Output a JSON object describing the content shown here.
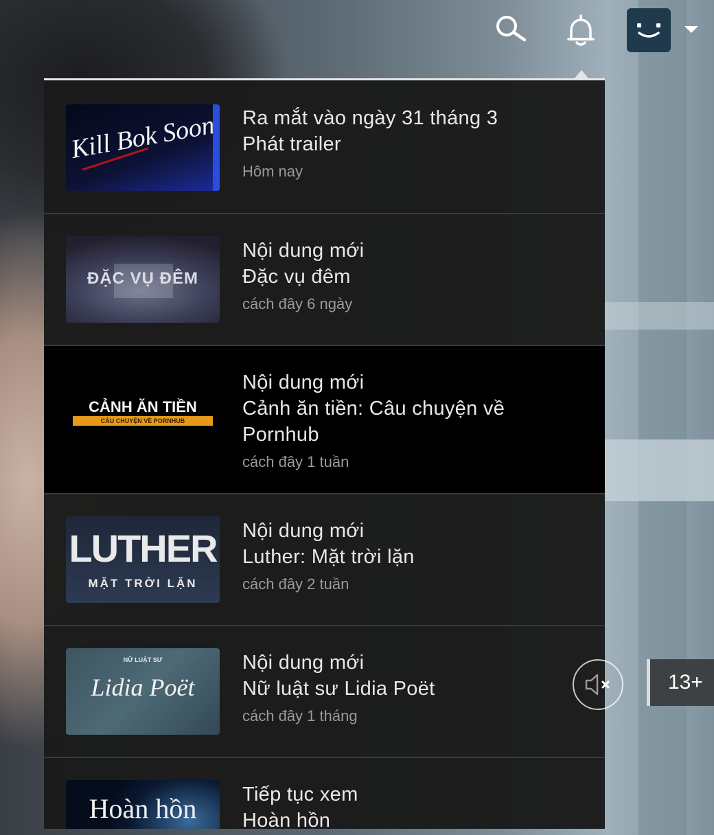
{
  "header": {
    "search_icon": "search-icon",
    "bell_icon": "bell-icon",
    "profile_icon": "profile-avatar-icon",
    "caret_icon": "caret-down-icon"
  },
  "notifications": [
    {
      "line1": "Ra mắt vào ngày 31 tháng 3",
      "line2": "Phát trailer",
      "time": "Hôm nay",
      "thumb_text": "Kill Bok Soon"
    },
    {
      "line1": "Nội dung mới",
      "line2": "Đặc vụ đêm",
      "time": "cách đây 6 ngày",
      "thumb_text": "ĐẶC VỤ ĐÊM"
    },
    {
      "line1": "Nội dung mới",
      "line2": "Cảnh ăn tiền: Câu chuyện về",
      "line3": "Pornhub",
      "time": "cách đây 1 tuần",
      "thumb_text": "CẢNH ĂN TIỀN",
      "thumb_sub": "CÂU CHUYỆN VỀ PORNHUB"
    },
    {
      "line1": "Nội dung mới",
      "line2": "Luther: Mặt trời lặn",
      "time": "cách đây 2 tuần",
      "thumb_text": "LUTHER",
      "thumb_sub": "MẶT TRỜI LẶN"
    },
    {
      "line1": "Nội dung mới",
      "line2": "Nữ luật sư Lidia Poët",
      "time": "cách đây 1 tháng",
      "thumb_pre": "NỮ LUẬT SƯ",
      "thumb_text": "Lidia Poët"
    },
    {
      "line1": "Tiếp tục xem",
      "line2": "Hoàn hồn",
      "thumb_text": "Hoàn hồn"
    }
  ],
  "mute_icon": "speaker-muted-icon",
  "rating": "13+",
  "colors": {
    "panel_border": "#e5e5e5",
    "highlight_bg": "#000000",
    "item_bg": "#1c1c1c",
    "meta_text": "#9a9a9a"
  }
}
